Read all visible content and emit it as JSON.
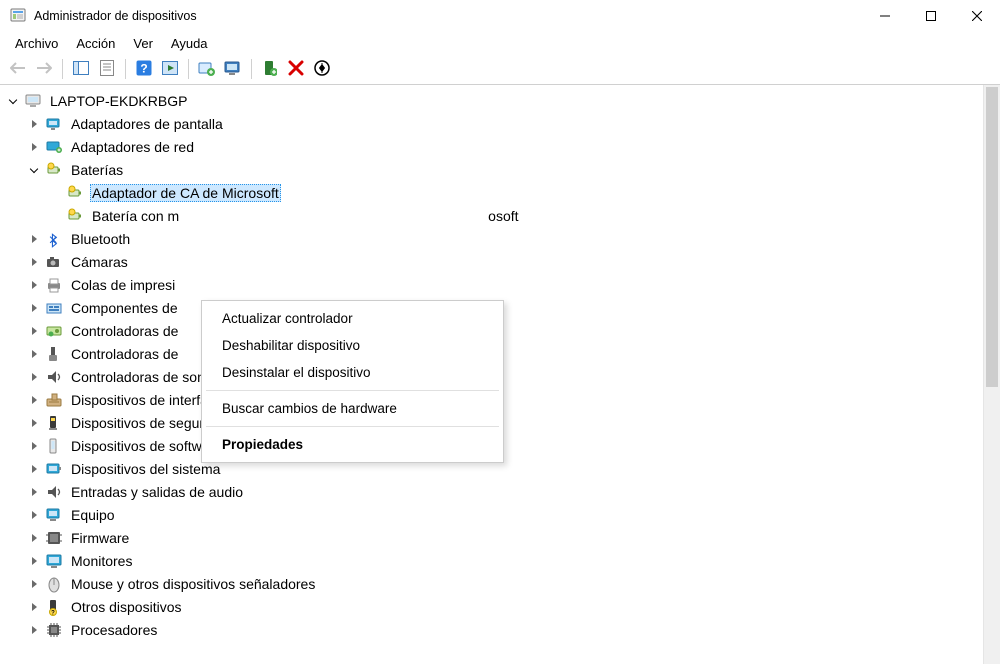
{
  "titlebar": {
    "title": "Administrador de dispositivos"
  },
  "menu": [
    "Archivo",
    "Acción",
    "Ver",
    "Ayuda"
  ],
  "tree_root": "LAPTOP-EKDKRBGP",
  "categories": [
    {
      "label": "Adaptadores de pantalla",
      "icon": "display-adapter",
      "expanded": false
    },
    {
      "label": "Adaptadores de red",
      "icon": "network-adapter",
      "expanded": false
    },
    {
      "label": "Baterías",
      "icon": "battery",
      "expanded": true,
      "children": [
        {
          "label": "Adaptador de CA de Microsoft",
          "icon": "battery",
          "selected": true
        },
        {
          "label": "Batería con m",
          "label_tail": "osoft",
          "icon": "battery"
        }
      ]
    },
    {
      "label": "Bluetooth",
      "icon": "bluetooth",
      "expanded": false
    },
    {
      "label": "Cámaras",
      "icon": "camera",
      "expanded": false
    },
    {
      "label": "Colas de impresi",
      "label_tail": "",
      "icon": "printer",
      "expanded": false,
      "truncated": true
    },
    {
      "label": "Componentes de",
      "icon": "software-component",
      "expanded": false,
      "truncated": true
    },
    {
      "label": "Controladoras de",
      "icon": "storage-controller",
      "expanded": false,
      "truncated": true
    },
    {
      "label": "Controladoras de",
      "icon": "usb-controller",
      "expanded": false,
      "truncated": true
    },
    {
      "label": "Controladoras de sonido y vídeo y dispositivos de juego",
      "icon": "sound-controller",
      "expanded": false
    },
    {
      "label": "Dispositivos de interfaz de usuario (HID)",
      "icon": "hid",
      "expanded": false
    },
    {
      "label": "Dispositivos de seguridad",
      "icon": "security-device",
      "expanded": false
    },
    {
      "label": "Dispositivos de software",
      "icon": "software-device",
      "expanded": false
    },
    {
      "label": "Dispositivos del sistema",
      "icon": "system-device",
      "expanded": false
    },
    {
      "label": "Entradas y salidas de audio",
      "icon": "audio-io",
      "expanded": false
    },
    {
      "label": "Equipo",
      "icon": "computer",
      "expanded": false
    },
    {
      "label": "Firmware",
      "icon": "firmware",
      "expanded": false
    },
    {
      "label": "Monitores",
      "icon": "monitor",
      "expanded": false
    },
    {
      "label": "Mouse y otros dispositivos señaladores",
      "icon": "mouse",
      "expanded": false
    },
    {
      "label": "Otros dispositivos",
      "icon": "other-device",
      "expanded": false
    },
    {
      "label": "Procesadores",
      "icon": "processor",
      "expanded": false
    }
  ],
  "context_menu": {
    "items": [
      {
        "label": "Actualizar controlador",
        "bold": false
      },
      {
        "label": "Deshabilitar dispositivo",
        "bold": false
      },
      {
        "label": "Desinstalar el dispositivo",
        "bold": false
      },
      {
        "sep": true
      },
      {
        "label": "Buscar cambios de hardware",
        "bold": false
      },
      {
        "sep": true
      },
      {
        "label": "Propiedades",
        "bold": true
      }
    ]
  }
}
